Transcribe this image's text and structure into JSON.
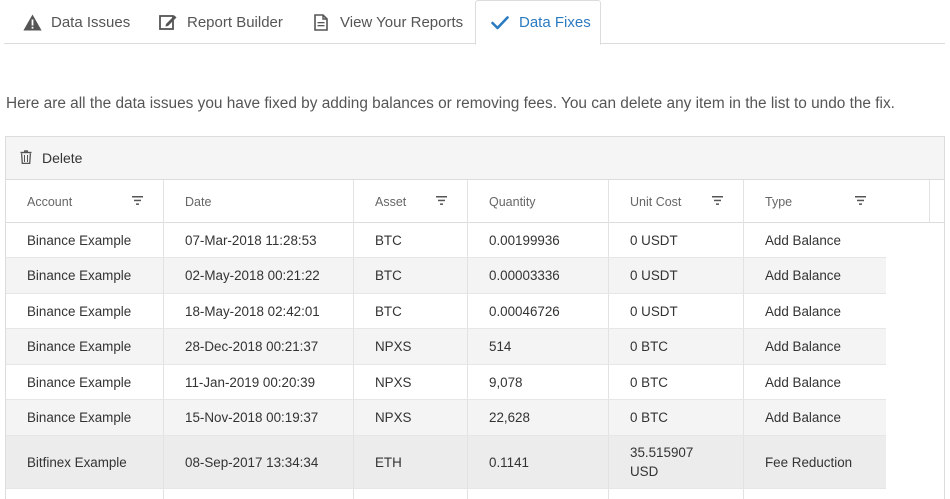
{
  "tabs": [
    {
      "label": "Data Issues",
      "icon": "warning-icon"
    },
    {
      "label": "Report Builder",
      "icon": "edit-icon"
    },
    {
      "label": "View Your Reports",
      "icon": "document-icon"
    },
    {
      "label": "Data Fixes",
      "icon": "checkmark-icon",
      "active": true
    }
  ],
  "intro_text": "Here are all the data issues you have fixed by adding balances or removing fees. You can delete any item in the list to undo the fix.",
  "toolbar": {
    "delete_label": "Delete",
    "delete_icon": "trash-icon"
  },
  "columns": [
    "Account",
    "Date",
    "Asset",
    "Quantity",
    "Unit Cost",
    "Type"
  ],
  "filterable_columns": [
    "Account",
    "Asset",
    "Unit Cost",
    "Type"
  ],
  "rows": [
    {
      "account": "Binance Example",
      "date": "07-Mar-2018 11:28:53",
      "asset": "BTC",
      "quantity": "0.00199936",
      "unit_cost": "0 USDT",
      "type": "Add Balance"
    },
    {
      "account": "Binance Example",
      "date": "02-May-2018 00:21:22",
      "asset": "BTC",
      "quantity": "0.00003336",
      "unit_cost": "0 USDT",
      "type": "Add Balance"
    },
    {
      "account": "Binance Example",
      "date": "18-May-2018 02:42:01",
      "asset": "BTC",
      "quantity": "0.00046726",
      "unit_cost": "0 USDT",
      "type": "Add Balance"
    },
    {
      "account": "Binance Example",
      "date": "28-Dec-2018 00:21:37",
      "asset": "NPXS",
      "quantity": "514",
      "unit_cost": "0 BTC",
      "type": "Add Balance"
    },
    {
      "account": "Binance Example",
      "date": "11-Jan-2019 00:20:39",
      "asset": "NPXS",
      "quantity": "9,078",
      "unit_cost": "0 BTC",
      "type": "Add Balance"
    },
    {
      "account": "Binance Example",
      "date": "15-Nov-2018 00:19:37",
      "asset": "NPXS",
      "quantity": "22,628",
      "unit_cost": "0 BTC",
      "type": "Add Balance"
    },
    {
      "account": "Bitfinex Example",
      "date": "08-Sep-2017 13:34:34",
      "asset": "ETH",
      "quantity": "0.1141",
      "unit_cost": "35.515907 USD",
      "type": "Fee Reduction"
    }
  ],
  "colors": {
    "accent": "#2b7bc0",
    "border": "#dcdcdc",
    "row_alt": "#f4f4f4",
    "row_selected": "#ececec"
  }
}
